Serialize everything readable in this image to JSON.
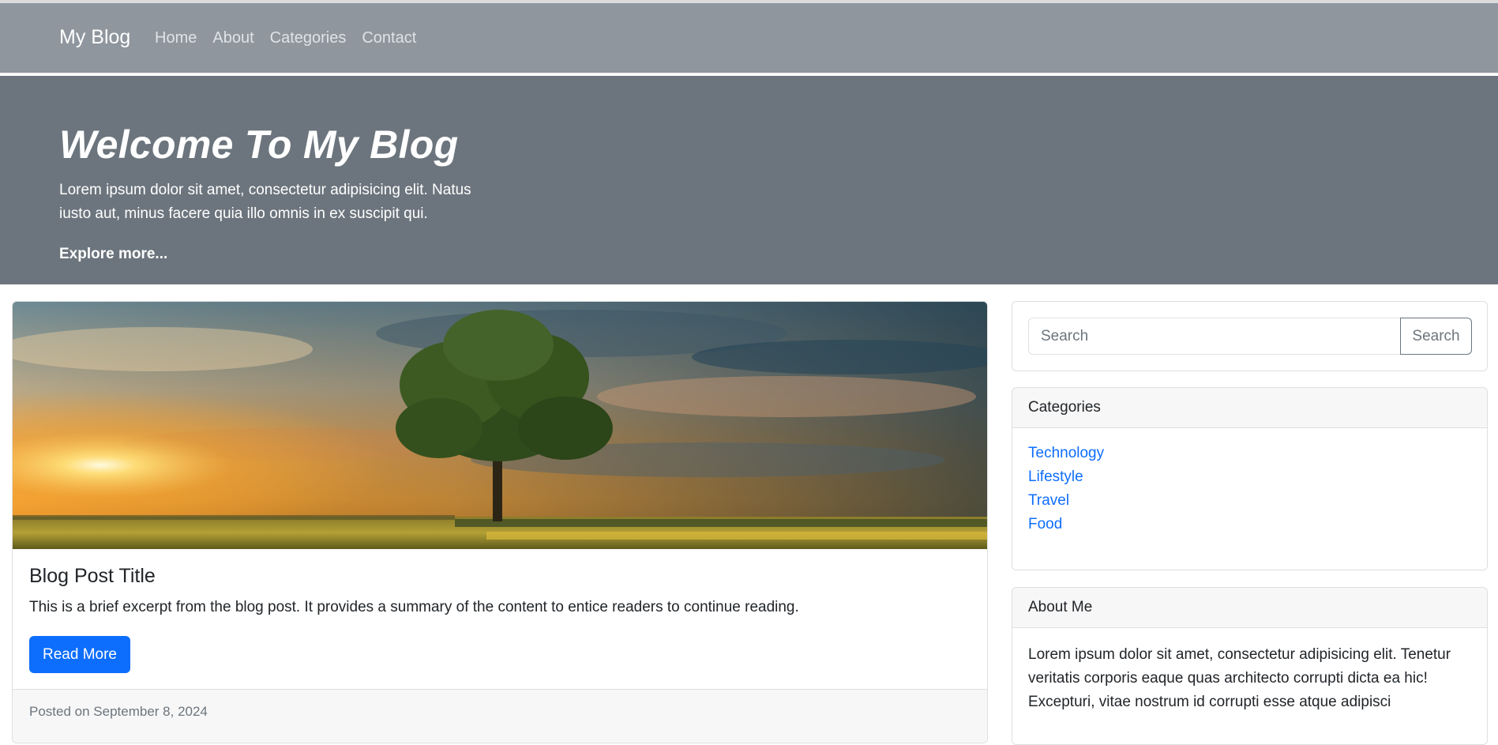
{
  "nav": {
    "brand": "My Blog",
    "links": [
      "Home",
      "About",
      "Categories",
      "Contact"
    ]
  },
  "hero": {
    "title": "Welcome To My Blog",
    "text": "Lorem ipsum dolor sit amet, consectetur adipisicing elit. Natus iusto aut, minus facere quia illo omnis in ex suscipit qui.",
    "cta": "Explore more..."
  },
  "post": {
    "title": "Blog Post Title",
    "excerpt": "This is a brief excerpt from the blog post. It provides a summary of the content to entice readers to continue reading.",
    "button": "Read More",
    "meta": "Posted on September 8, 2024"
  },
  "sidebar": {
    "search": {
      "placeholder": "Search",
      "button": "Search"
    },
    "categories": {
      "title": "Categories",
      "items": [
        "Technology",
        "Lifestyle",
        "Travel",
        "Food"
      ]
    },
    "about": {
      "title": "About Me",
      "text": "Lorem ipsum dolor sit amet, consectetur adipisicing elit. Tenetur veritatis corporis eaque quas architecto corrupti dicta ea hic! Excepturi, vitae nostrum id corrupti esse atque adipisci"
    }
  },
  "colors": {
    "navbar": "#8f969e",
    "hero": "#6c757d",
    "primary": "#0d6efd",
    "link": "#0d6efd"
  },
  "icons": [
    "sunset-landscape-image"
  ]
}
